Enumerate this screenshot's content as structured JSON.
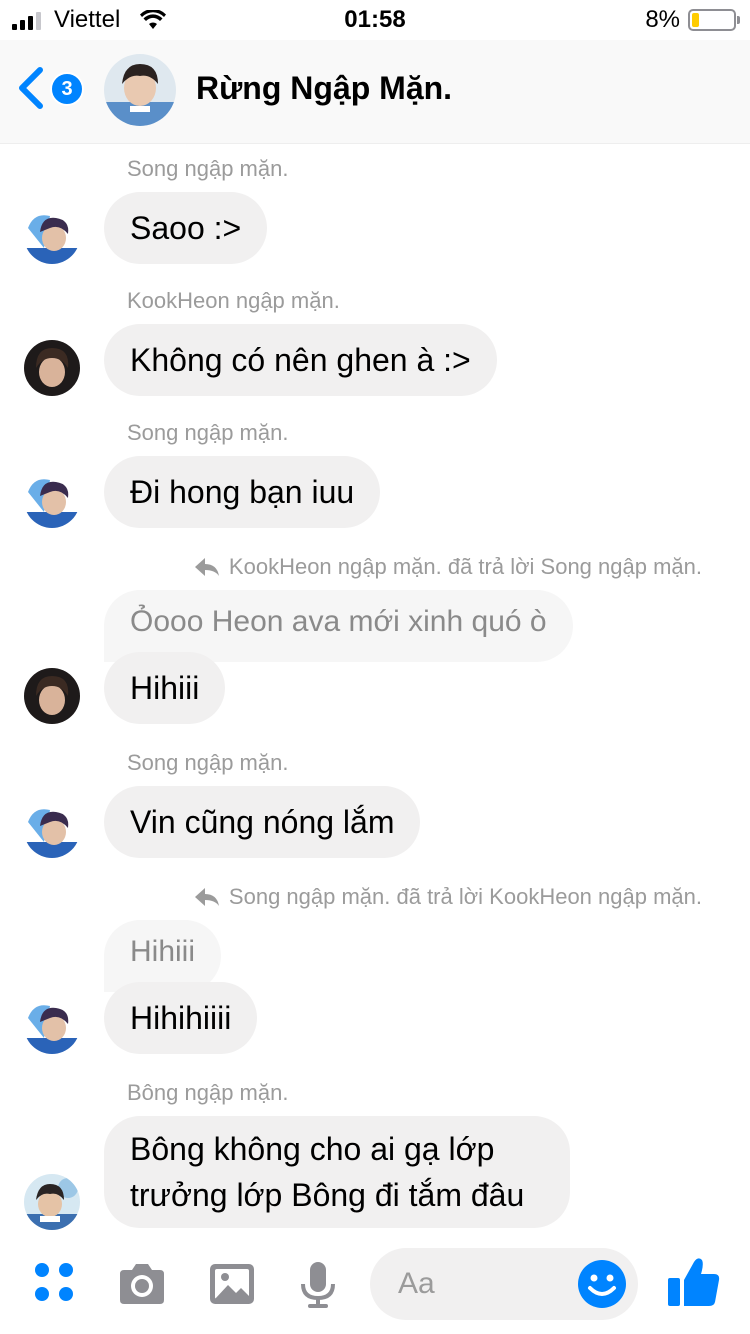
{
  "status_bar": {
    "carrier": "Viettel",
    "time": "01:58",
    "battery": "8%",
    "battery_level_fraction": 0.08
  },
  "header": {
    "back_badge": "3",
    "title": "Rừng Ngập Mặn."
  },
  "messages": [
    {
      "sender": "Song ngập mặn.",
      "text": "Saoo :>"
    },
    {
      "sender": "KookHeon ngập mặn.",
      "text": "Không có nên ghen à :>"
    },
    {
      "sender": "Song ngập mặn.",
      "text": "Đi hong bạn iuu"
    },
    {
      "reply_note": "KookHeon ngập mặn. đã trả lời Song ngập mặn.",
      "quoted": "Ỏooo Heon ava mới xinh quó ò",
      "text": "Hihiii"
    },
    {
      "sender": "Song ngập mặn.",
      "text": "Vin cũng nóng lắm"
    },
    {
      "reply_note": "Song ngập mặn. đã trả lời KookHeon ngập mặn.",
      "quoted": "Hihiii",
      "text": "Hihihiiii"
    },
    {
      "sender": "Bông ngập mặn.",
      "text": "Bông không cho ai gạ lớp trưởng lớp Bông đi tắm đâu"
    }
  ],
  "composer": {
    "placeholder": "Aa"
  },
  "colors": {
    "accent": "#0084ff",
    "bubble": "#f1f0f0",
    "meta_text": "#9b9b9b"
  },
  "icons": {
    "apps": "four-dots-icon",
    "camera": "camera-icon",
    "gallery": "image-icon",
    "voice": "microphone-icon",
    "emoji": "smiley-icon",
    "like": "thumbs-up-icon"
  }
}
